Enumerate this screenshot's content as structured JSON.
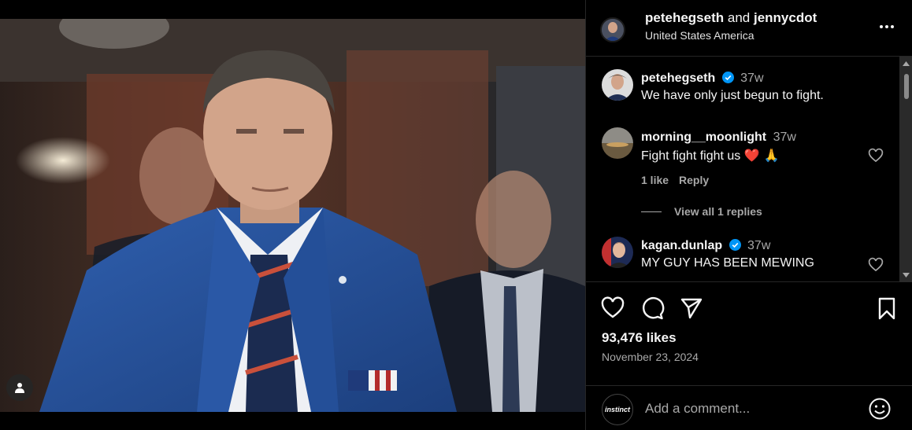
{
  "post": {
    "author": "petehegseth",
    "joiner": "and",
    "collaborator": "jennycdot",
    "location": "United States America",
    "likes": "93,476 likes",
    "date": "November 23, 2024"
  },
  "comments": [
    {
      "user": "petehegseth",
      "verified": true,
      "time": "37w",
      "text": "We have only just begun to fight."
    },
    {
      "user": "morning__moonlight",
      "verified": false,
      "time": "37w",
      "text": "Fight fight fight us",
      "emoji": "❤️ 🙏",
      "likes": "1 like",
      "reply": "Reply",
      "view_replies": "View all 1 replies"
    },
    {
      "user": "kagan.dunlap",
      "verified": true,
      "time": "37w",
      "text": "MY GUY HAS BEEN MEWING"
    }
  ],
  "comment_box": {
    "avatar_text": "instinct",
    "placeholder": "Add a comment..."
  },
  "icons": {
    "more": "more-horizontal-icon",
    "like": "heart-icon",
    "comment": "comment-bubble-icon",
    "share": "send-icon",
    "save": "bookmark-icon",
    "emoji": "emoji-smile-icon",
    "user_tag": "user-tag-icon",
    "verified": "verified-badge-icon"
  },
  "colors": {
    "verified": "#0095f6",
    "background": "#000000",
    "muted": "#a8a8a8",
    "divider": "#262626"
  }
}
